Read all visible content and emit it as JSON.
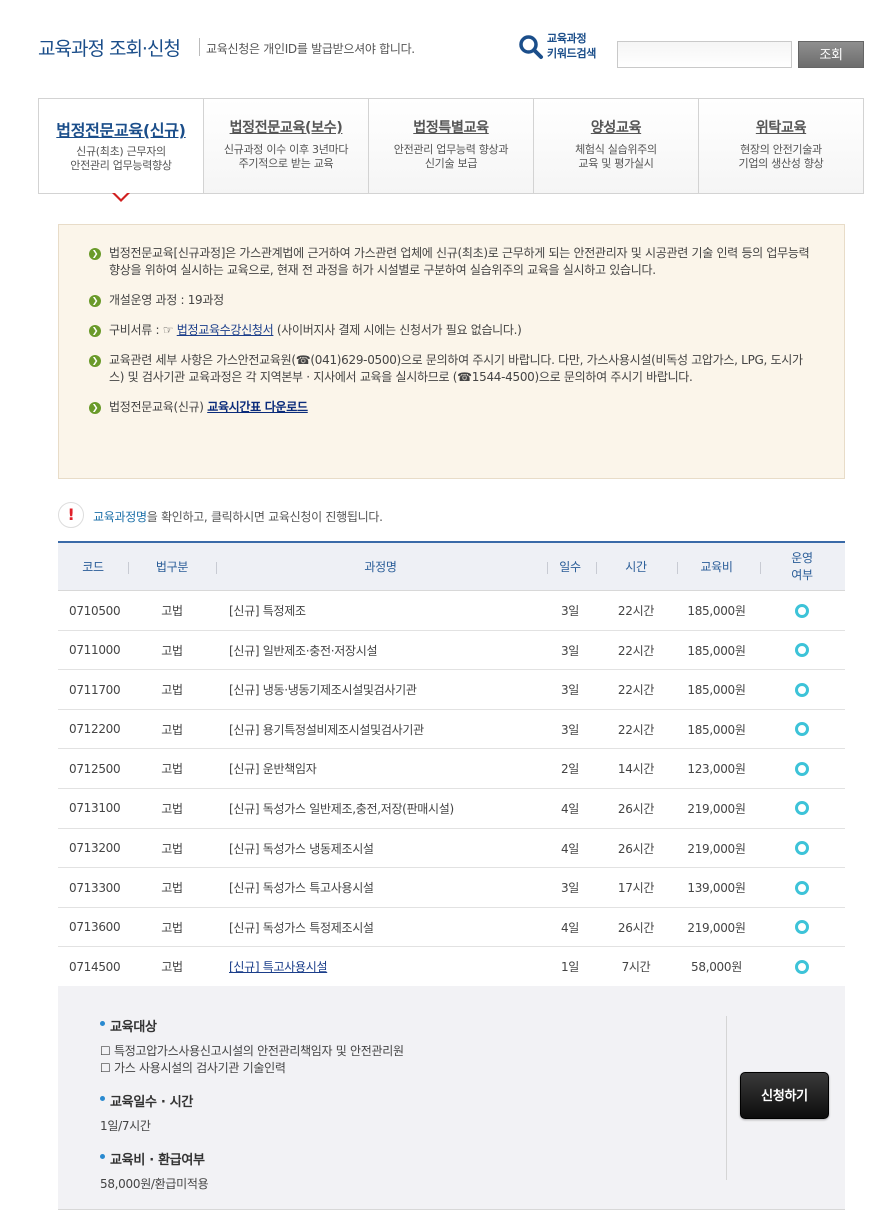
{
  "header": {
    "title": "교육과정 조회·신청",
    "notice": "교육신청은 개인ID를 발급받으셔야 합니다.",
    "keyword_label_line1": "교육과정",
    "keyword_label_line2": "키워드검색",
    "search_value": "",
    "search_button": "조회"
  },
  "tabs": [
    {
      "title": "법정전문교육(신규)",
      "desc": "신규(최초) 근무자의\n안전관리 업무능력향상",
      "active": true
    },
    {
      "title": "법정전문교육(보수)",
      "desc": "신규과정 이수 이후 3년마다\n주기적으로 받는 교육",
      "active": false
    },
    {
      "title": "법정특별교육",
      "desc": "안전관리 업무능력 향상과\n신기술 보급",
      "active": false
    },
    {
      "title": "양성교육",
      "desc": "체험식 실습위주의\n교육 및 평가실시",
      "active": false
    },
    {
      "title": "위탁교육",
      "desc": "현장의 안전기술과\n기업의 생산성 향상",
      "active": false
    }
  ],
  "info": {
    "item1": "법정전문교육[신규과정]은 가스관계법에 근거하여 가스관련 업체에 신규(최초)로 근무하게 되는 안전관리자 및 시공관련 기술 인력 등의 업무능력 향상을 위하여 실시하는 교육으로, 현재 전 과정을 허가 시설별로 구분하여 실습위주의 교육을 실시하고 있습니다.",
    "item2": "개설운영 과정 : 19과정",
    "item3_prefix": "구비서류 : ☞ ",
    "item3_link": "법정교육수강신청서",
    "item3_suffix": " (사이버지사 결제 시에는 신청서가 필요 없습니다.)",
    "item4": "교육관련 세부 사항은 가스안전교육원(☎(041)629-0500)으로 문의하여 주시기 바랍니다. 다만, 가스사용시설(비독성 고압가스, LPG, 도시가스) 및 검사기관 교육과정은 각 지역본부 · 지사에서 교육을 실시하므로 (☎1544-4500)으로 문의하여 주시기 바랍니다.",
    "item5_prefix": "법정전문교육(신규) ",
    "item5_link": "교육시간표 다운로드"
  },
  "notice": {
    "highlight": "교육과정명",
    "text": "을 확인하고, 클릭하시면 교육신청이 진행됩니다."
  },
  "table": {
    "headers": {
      "code": "코드",
      "law": "법구분",
      "name": "과정명",
      "days": "일수",
      "hours": "시간",
      "fee": "교육비",
      "op": "운영\n여부"
    },
    "rows": [
      {
        "code": "0710500",
        "law": "고법",
        "name": "[신규] 특정제조",
        "days": "3일",
        "hours": "22시간",
        "fee": "185,000원"
      },
      {
        "code": "0711000",
        "law": "고법",
        "name": "[신규] 일반제조·충전·저장시설",
        "days": "3일",
        "hours": "22시간",
        "fee": "185,000원"
      },
      {
        "code": "0711700",
        "law": "고법",
        "name": "[신규] 냉동·냉동기제조시설및검사기관",
        "days": "3일",
        "hours": "22시간",
        "fee": "185,000원"
      },
      {
        "code": "0712200",
        "law": "고법",
        "name": "[신규] 용기특정설비제조시설및검사기관",
        "days": "3일",
        "hours": "22시간",
        "fee": "185,000원"
      },
      {
        "code": "0712500",
        "law": "고법",
        "name": "[신규] 운반책임자",
        "days": "2일",
        "hours": "14시간",
        "fee": "123,000원"
      },
      {
        "code": "0713100",
        "law": "고법",
        "name": "[신규] 독성가스 일반제조,충전,저장(판매시설)",
        "days": "4일",
        "hours": "26시간",
        "fee": "219,000원"
      },
      {
        "code": "0713200",
        "law": "고법",
        "name": "[신규] 독성가스 냉동제조시설",
        "days": "4일",
        "hours": "26시간",
        "fee": "219,000원"
      },
      {
        "code": "0713300",
        "law": "고법",
        "name": "[신규] 독성가스 특고사용시설",
        "days": "3일",
        "hours": "17시간",
        "fee": "139,000원"
      },
      {
        "code": "0713600",
        "law": "고법",
        "name": "[신규] 독성가스 특정제조시설",
        "days": "4일",
        "hours": "26시간",
        "fee": "219,000원"
      },
      {
        "code": "0714500",
        "law": "고법",
        "name": "[신규] 특고사용시설",
        "days": "1일",
        "hours": "7시간",
        "fee": "58,000원"
      }
    ]
  },
  "detail": {
    "target_head": "교육대상",
    "target1": "☐ 특정고압가스사용신고시설의 안전관리책임자 및 안전관리원",
    "target2": "☐ 가스 사용시설의 검사기관 기술인력",
    "duration_head": "교육일수 · 시간",
    "duration": "1일/7시간",
    "fee_head": "교육비 · 환급여부",
    "fee": "58,000원/환급미적용",
    "apply_button": "신청하기"
  },
  "colors": {
    "accent": "#1b4e8a",
    "header_line": "#3a6aa8",
    "op_icon": "#3dc3d8",
    "alert": "#e0202a"
  }
}
